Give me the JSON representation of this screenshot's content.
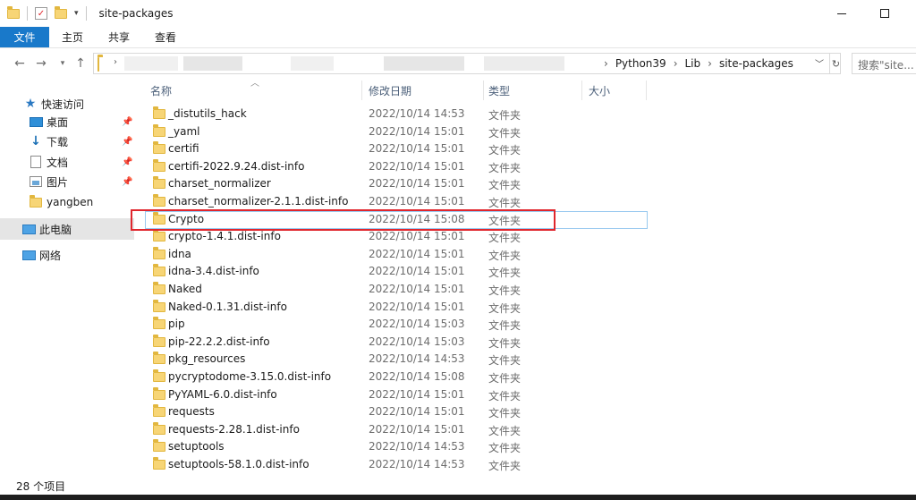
{
  "window": {
    "title": "site-packages"
  },
  "ribbon": {
    "tabs": [
      "文件",
      "主页",
      "共享",
      "查看"
    ]
  },
  "address": {
    "crumbs": [
      "Python39",
      "Lib",
      "site-packages"
    ],
    "search_placeholder": "搜索\"site..."
  },
  "navpane": {
    "quick_access": "快速访问",
    "items": [
      {
        "label": "桌面",
        "icon": "desktop-icon",
        "pinned": true
      },
      {
        "label": "下载",
        "icon": "download-icon",
        "pinned": true
      },
      {
        "label": "文档",
        "icon": "document-icon",
        "pinned": true
      },
      {
        "label": "图片",
        "icon": "picture-icon",
        "pinned": true
      },
      {
        "label": "yangben",
        "icon": "folder-icon",
        "pinned": false
      }
    ],
    "this_pc": "此电脑",
    "network": "网络"
  },
  "columns": {
    "name": "名称",
    "date": "修改日期",
    "type": "类型",
    "size": "大小"
  },
  "files": [
    {
      "name": "_distutils_hack",
      "date": "2022/10/14 14:53",
      "type": "文件夹"
    },
    {
      "name": "_yaml",
      "date": "2022/10/14 15:01",
      "type": "文件夹"
    },
    {
      "name": "certifi",
      "date": "2022/10/14 15:01",
      "type": "文件夹"
    },
    {
      "name": "certifi-2022.9.24.dist-info",
      "date": "2022/10/14 15:01",
      "type": "文件夹"
    },
    {
      "name": "charset_normalizer",
      "date": "2022/10/14 15:01",
      "type": "文件夹"
    },
    {
      "name": "charset_normalizer-2.1.1.dist-info",
      "date": "2022/10/14 15:01",
      "type": "文件夹"
    },
    {
      "name": "Crypto",
      "date": "2022/10/14 15:08",
      "type": "文件夹"
    },
    {
      "name": "crypto-1.4.1.dist-info",
      "date": "2022/10/14 15:01",
      "type": "文件夹"
    },
    {
      "name": "idna",
      "date": "2022/10/14 15:01",
      "type": "文件夹"
    },
    {
      "name": "idna-3.4.dist-info",
      "date": "2022/10/14 15:01",
      "type": "文件夹"
    },
    {
      "name": "Naked",
      "date": "2022/10/14 15:01",
      "type": "文件夹"
    },
    {
      "name": "Naked-0.1.31.dist-info",
      "date": "2022/10/14 15:01",
      "type": "文件夹"
    },
    {
      "name": "pip",
      "date": "2022/10/14 15:03",
      "type": "文件夹"
    },
    {
      "name": "pip-22.2.2.dist-info",
      "date": "2022/10/14 15:03",
      "type": "文件夹"
    },
    {
      "name": "pkg_resources",
      "date": "2022/10/14 14:53",
      "type": "文件夹"
    },
    {
      "name": "pycryptodome-3.15.0.dist-info",
      "date": "2022/10/14 15:08",
      "type": "文件夹"
    },
    {
      "name": "PyYAML-6.0.dist-info",
      "date": "2022/10/14 15:01",
      "type": "文件夹"
    },
    {
      "name": "requests",
      "date": "2022/10/14 15:01",
      "type": "文件夹"
    },
    {
      "name": "requests-2.28.1.dist-info",
      "date": "2022/10/14 15:01",
      "type": "文件夹"
    },
    {
      "name": "setuptools",
      "date": "2022/10/14 14:53",
      "type": "文件夹"
    },
    {
      "name": "setuptools-58.1.0.dist-info",
      "date": "2022/10/14 14:53",
      "type": "文件夹"
    }
  ],
  "status": {
    "count": "28 个项目"
  },
  "colors": {
    "accent": "#1979ca",
    "highlight": "#e0262d",
    "folder": "#f7d576"
  }
}
